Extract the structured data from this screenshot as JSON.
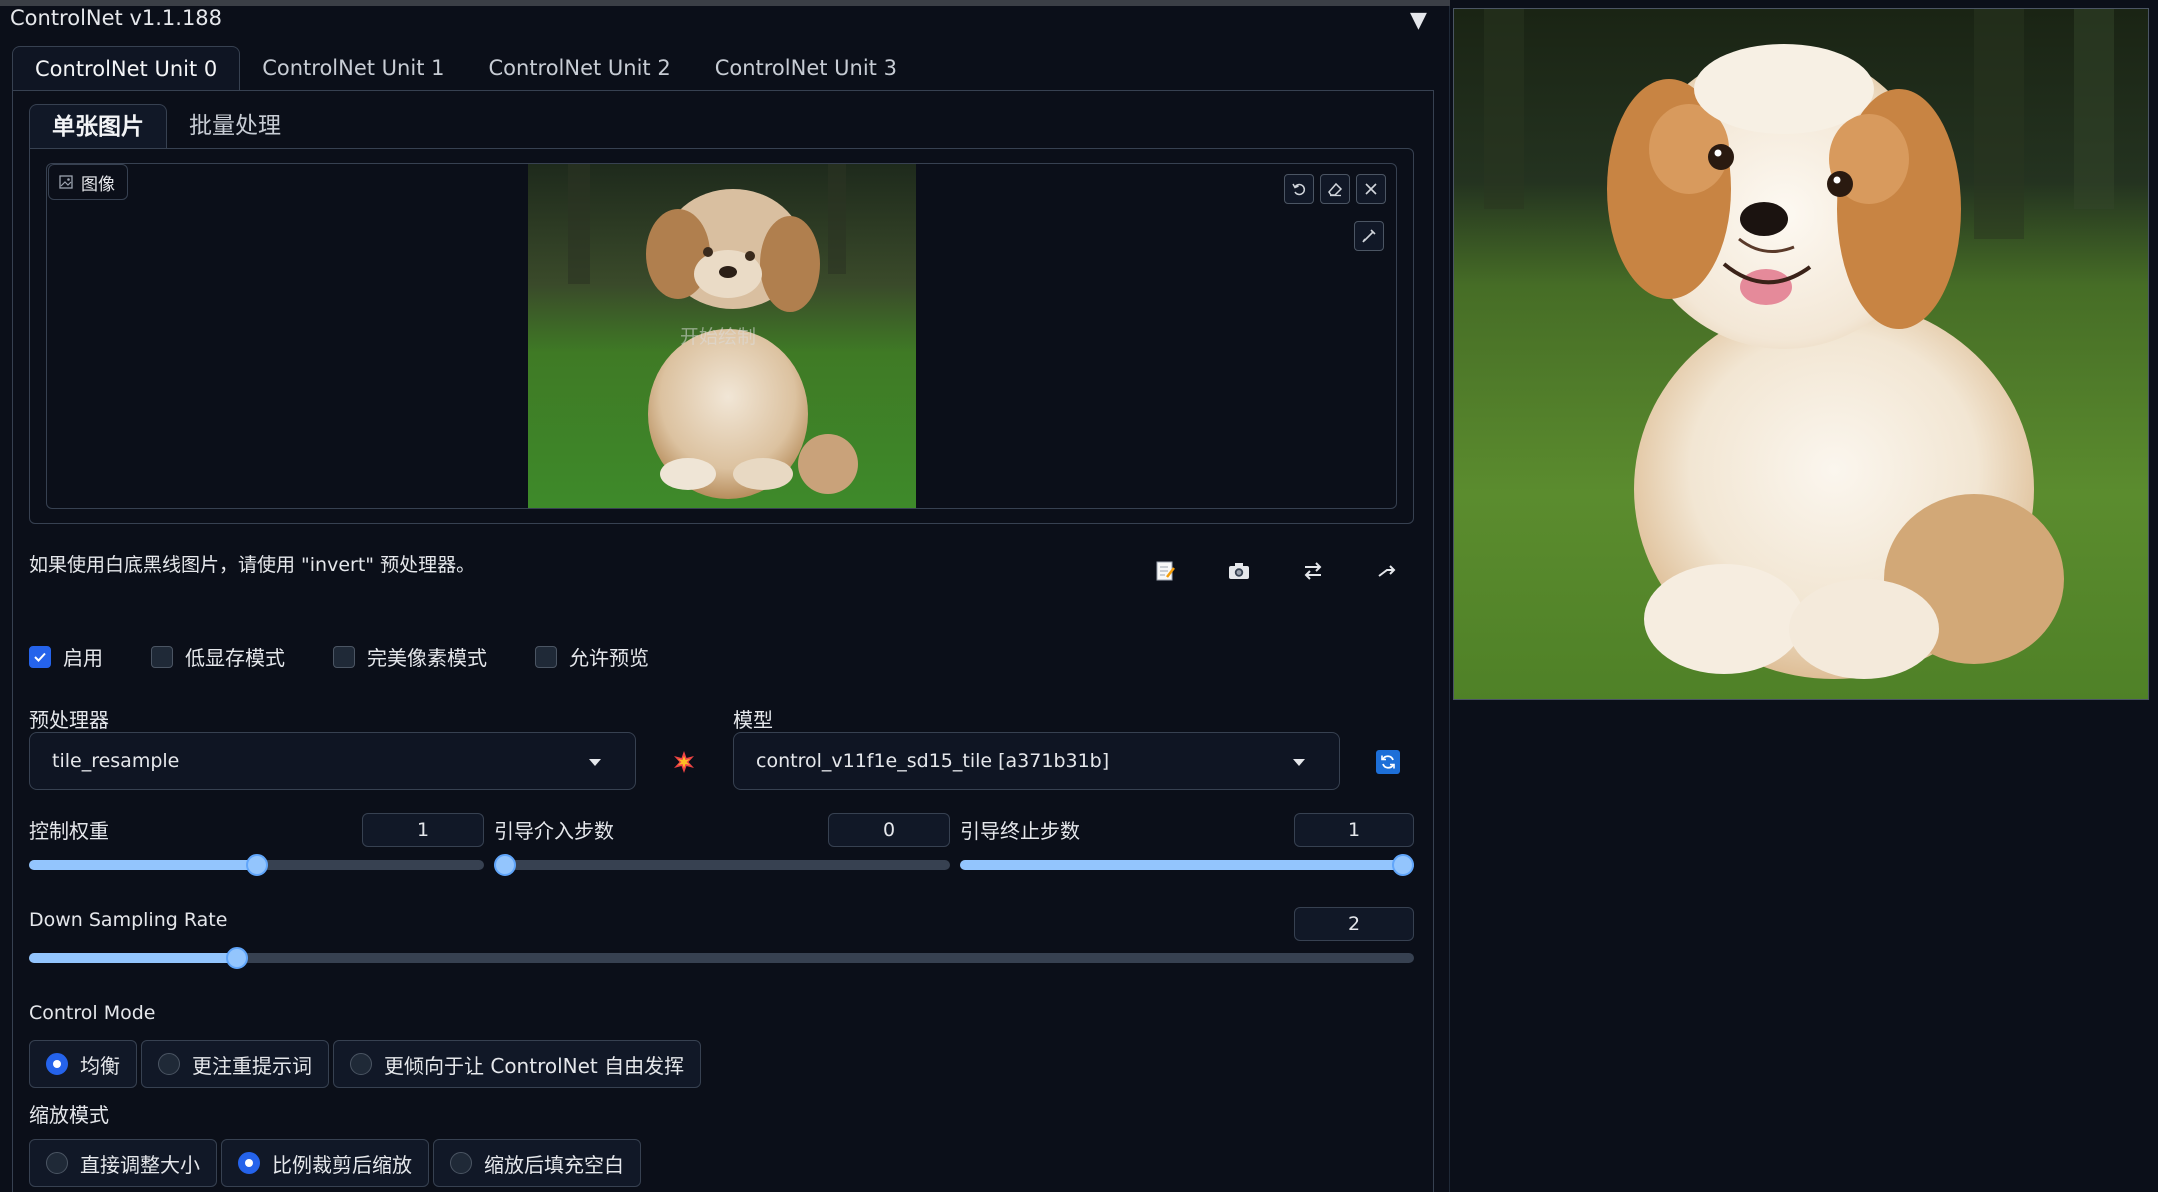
{
  "accordion": {
    "title": "ControlNet v1.1.188",
    "arrow": "▼"
  },
  "unit_tabs": [
    "ControlNet Unit 0",
    "ControlNet Unit 1",
    "ControlNet Unit 2",
    "ControlNet Unit 3"
  ],
  "sub_tabs": [
    "单张图片",
    "批量处理"
  ],
  "image_input": {
    "label": "图像",
    "overlay_text": "开始绘制"
  },
  "hint_text": "如果使用白底黑线图片，请使用 \"invert\" 预处理器。",
  "checkboxes": [
    {
      "label": "启用",
      "checked": true
    },
    {
      "label": "低显存模式",
      "checked": false
    },
    {
      "label": "完美像素模式",
      "checked": false
    },
    {
      "label": "允许预览",
      "checked": false
    }
  ],
  "preprocessor": {
    "label": "预处理器",
    "value": "tile_resample"
  },
  "model": {
    "label": "模型",
    "value": "control_v11f1e_sd15_tile [a371b31b]"
  },
  "sliders": {
    "weight": {
      "label": "控制权重",
      "value": "1",
      "fraction": 0.5
    },
    "start": {
      "label": "引导介入步数",
      "value": "0",
      "fraction": 0.0
    },
    "end": {
      "label": "引导终止步数",
      "value": "1",
      "fraction": 1.0
    },
    "down_sampling": {
      "label": "Down Sampling Rate",
      "value": "2",
      "fraction": 0.15
    }
  },
  "control_mode": {
    "label": "Control Mode",
    "options": [
      "均衡",
      "更注重提示词",
      "更倾向于让 ControlNet 自由发挥"
    ],
    "selected": 0
  },
  "resize_mode": {
    "label": "缩放模式",
    "options": [
      "直接调整大小",
      "比例裁剪后缩放",
      "缩放后填充空白"
    ],
    "selected": 1
  },
  "colors": {
    "accent": "#2563eb",
    "slider": "#93c5fd",
    "background": "#0b0f19"
  }
}
